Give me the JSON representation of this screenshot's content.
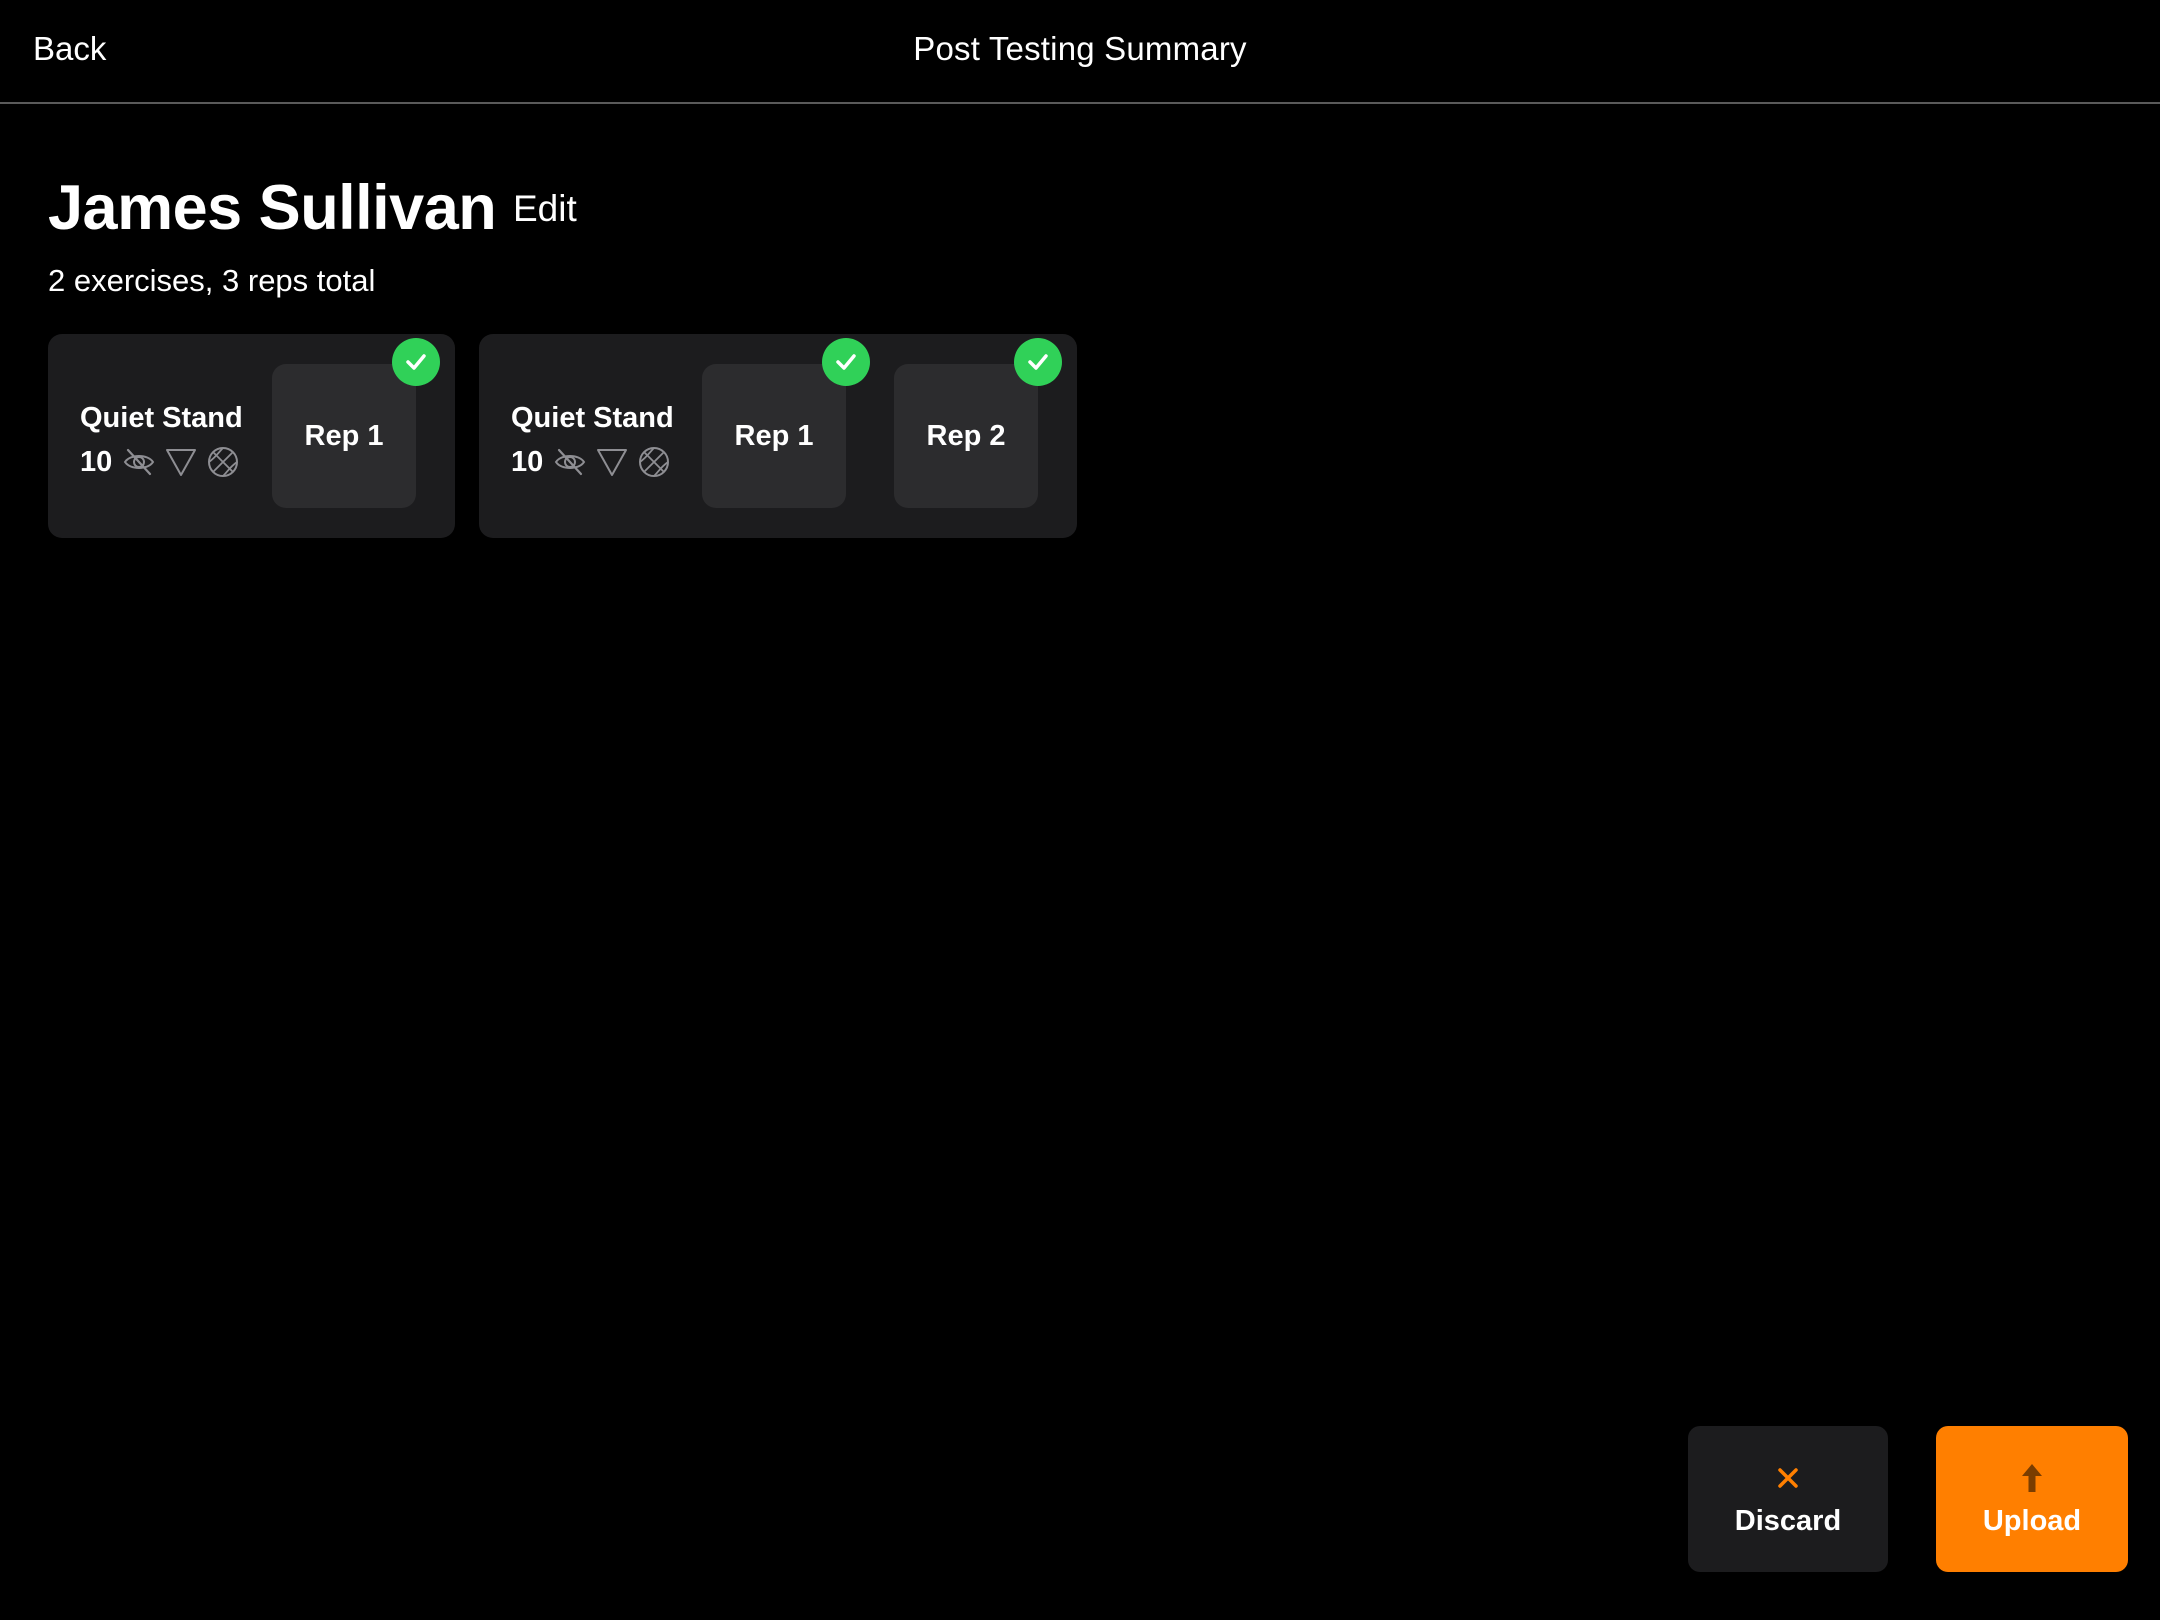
{
  "nav": {
    "back_label": "Back",
    "title": "Post Testing Summary"
  },
  "athlete": {
    "name": "James Sullivan",
    "edit_label": "Edit",
    "summary": "2 exercises, 3 reps total"
  },
  "exercises": [
    {
      "name": "Quiet Stand",
      "duration": "10",
      "icons": [
        "eye-slash-icon",
        "triangle-down-icon",
        "ball-icon"
      ],
      "reps": [
        {
          "label": "Rep 1",
          "completed": true
        }
      ]
    },
    {
      "name": "Quiet Stand",
      "duration": "10",
      "icons": [
        "eye-slash-icon",
        "triangle-down-icon",
        "ball-icon"
      ],
      "reps": [
        {
          "label": "Rep 1",
          "completed": true
        },
        {
          "label": "Rep 2",
          "completed": true
        }
      ]
    }
  ],
  "actions": {
    "discard_label": "Discard",
    "upload_label": "Upload"
  },
  "colors": {
    "accent": "#ff7f00",
    "success": "#30d158",
    "card": "#1c1c1e",
    "tile": "#2c2c2e",
    "background": "#000000"
  }
}
